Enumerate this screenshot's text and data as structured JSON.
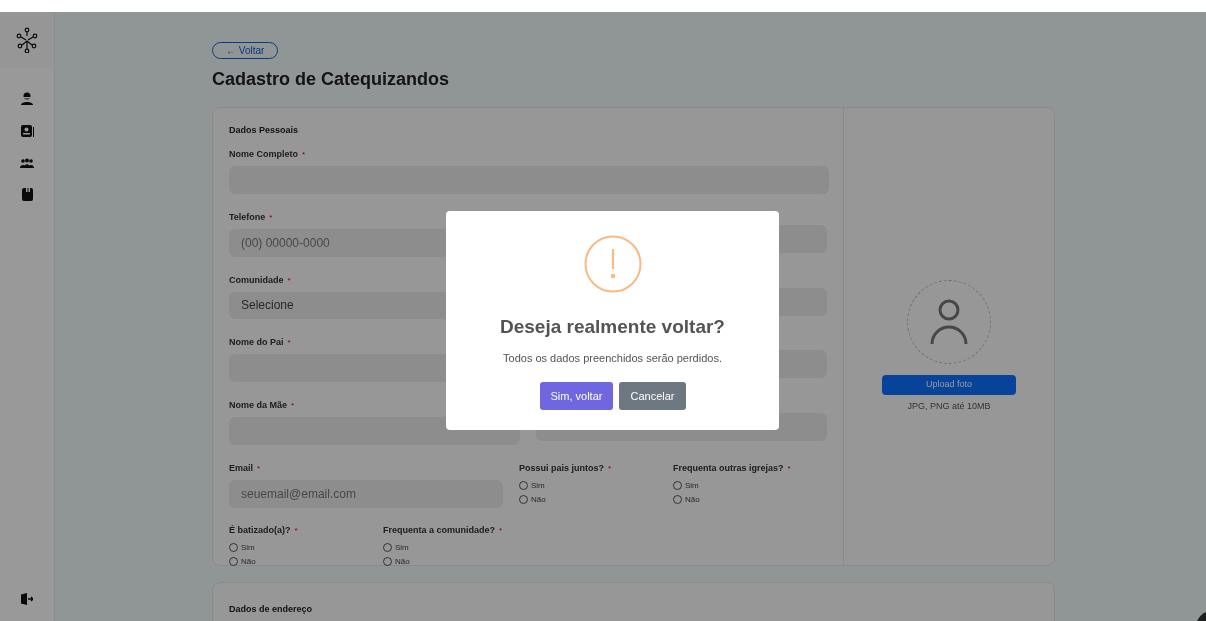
{
  "back_button": "← Voltar",
  "page_title": "Cadastro de Catequizandos",
  "personal": {
    "title": "Dados Pessoais",
    "full_name": {
      "label": "Nome Completo",
      "mark": "*"
    },
    "pairs": [
      {
        "left": {
          "kind": "text",
          "label": "Telefone",
          "mark": "*",
          "placeholder": "(00) 00000-0000"
        },
        "right": {
          "kind": "text"
        }
      },
      {
        "left": {
          "kind": "select",
          "label": "Comunidade",
          "mark": "*",
          "value": "Selecione"
        },
        "right": {
          "kind": "text"
        }
      },
      {
        "left": {
          "kind": "text",
          "label": "Nome do Pai",
          "mark": "*"
        },
        "right": {
          "kind": "text"
        }
      },
      {
        "left": {
          "kind": "text",
          "label": "Nome da Mãe",
          "mark": "*"
        },
        "right": {
          "kind": "text"
        }
      }
    ],
    "email": {
      "kind": "text",
      "label": "Email",
      "mark": "*",
      "placeholder": "seuemail@email.com"
    },
    "radio_groups_row1": [
      {
        "label": "Possui pais juntos?",
        "mark": "*",
        "options": [
          {
            "label": "Sim",
            "selected": false
          },
          {
            "label": "Não",
            "selected": false
          }
        ]
      },
      {
        "label": "Frequenta outras igrejas?",
        "mark": "*",
        "options": [
          {
            "label": "Sim",
            "selected": false
          },
          {
            "label": "Não",
            "selected": false
          }
        ]
      }
    ],
    "radio_groups_row2": [
      {
        "label": "É batizado(a)?",
        "mark": "*",
        "options": [
          {
            "label": "Sim",
            "selected": false
          },
          {
            "label": "Não",
            "selected": false
          }
        ]
      },
      {
        "label": "Frequenta a comunidade?",
        "mark": "*",
        "options": [
          {
            "label": "Sim",
            "selected": false
          },
          {
            "label": "Não",
            "selected": false
          }
        ]
      }
    ]
  },
  "photo": {
    "button": "Upload foto",
    "hint": "JPG, PNG até 10MB"
  },
  "address": {
    "title": "Dados de endereço"
  },
  "dialog": {
    "title": "Deseja realmente voltar?",
    "message": "Todos os dados preenchidos serão perdidos.",
    "confirm": "Sim, voltar",
    "cancel": "Cancelar"
  }
}
